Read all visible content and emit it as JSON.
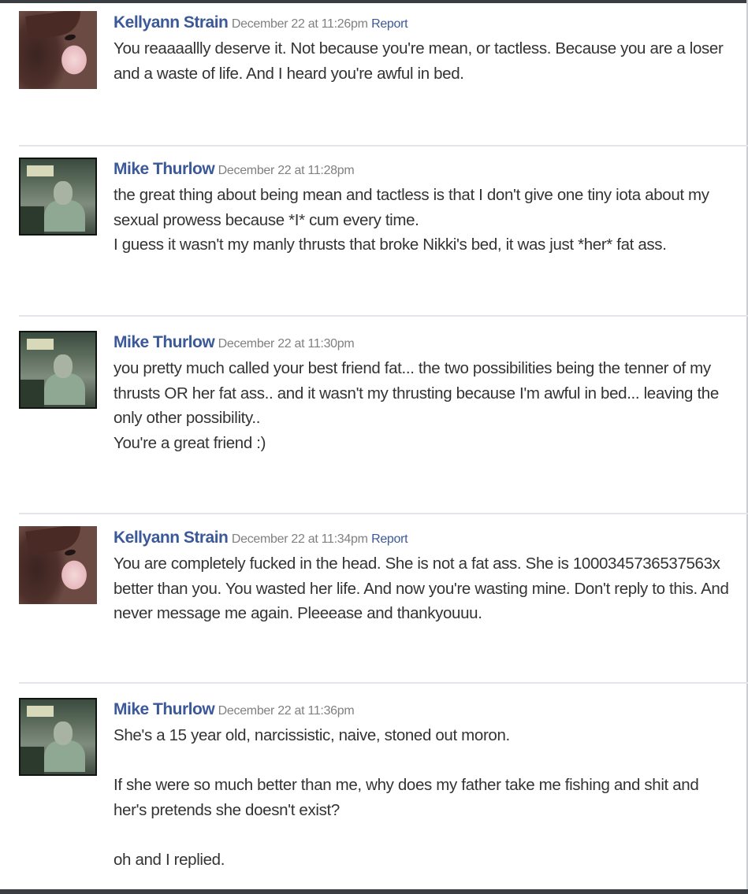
{
  "messages": [
    {
      "author": "Kellyann Strain",
      "time": "December 22 at 11:26pm",
      "report": "Report",
      "paragraphs": [
        "You reaaaallly deserve it. Not because you're mean, or tactless. Because you are a loser and a waste of life. And I heard you're awful in bed."
      ]
    },
    {
      "author": "Mike Thurlow",
      "time": "December 22 at 11:28pm",
      "paragraphs": [
        "the great thing about being mean and tactless is that I don't give one tiny iota about my sexual prowess because *I* cum every time.",
        "I guess it wasn't my manly thrusts that broke Nikki's bed, it was just *her* fat ass."
      ]
    },
    {
      "author": "Mike Thurlow",
      "time": "December 22 at 11:30pm",
      "paragraphs": [
        "you pretty much called your best friend fat... the two possibilities being the tenner of my thrusts OR her fat ass.. and it wasn't my thrusting because I'm awful in bed... leaving the only other possibility..",
        "You're a great friend :)"
      ]
    },
    {
      "author": "Kellyann Strain",
      "time": "December 22 at 11:34pm",
      "report": "Report",
      "paragraphs": [
        "You are completely fucked in the head. She is not a fat ass. She is 1000345736537563x better than you. You wasted her life. And now you're wasting mine. Don't reply to this. And never message me again. Pleeease and thankyouuu."
      ]
    },
    {
      "author": "Mike Thurlow",
      "time": "December 22 at 11:36pm",
      "paragraphs": [
        "She's a 15 year old, narcissistic, naive, stoned out moron.",
        "If she were so much better than me, why does my father take me fishing and shit and her's pretends she doesn't exist?",
        "oh and I replied."
      ]
    }
  ]
}
